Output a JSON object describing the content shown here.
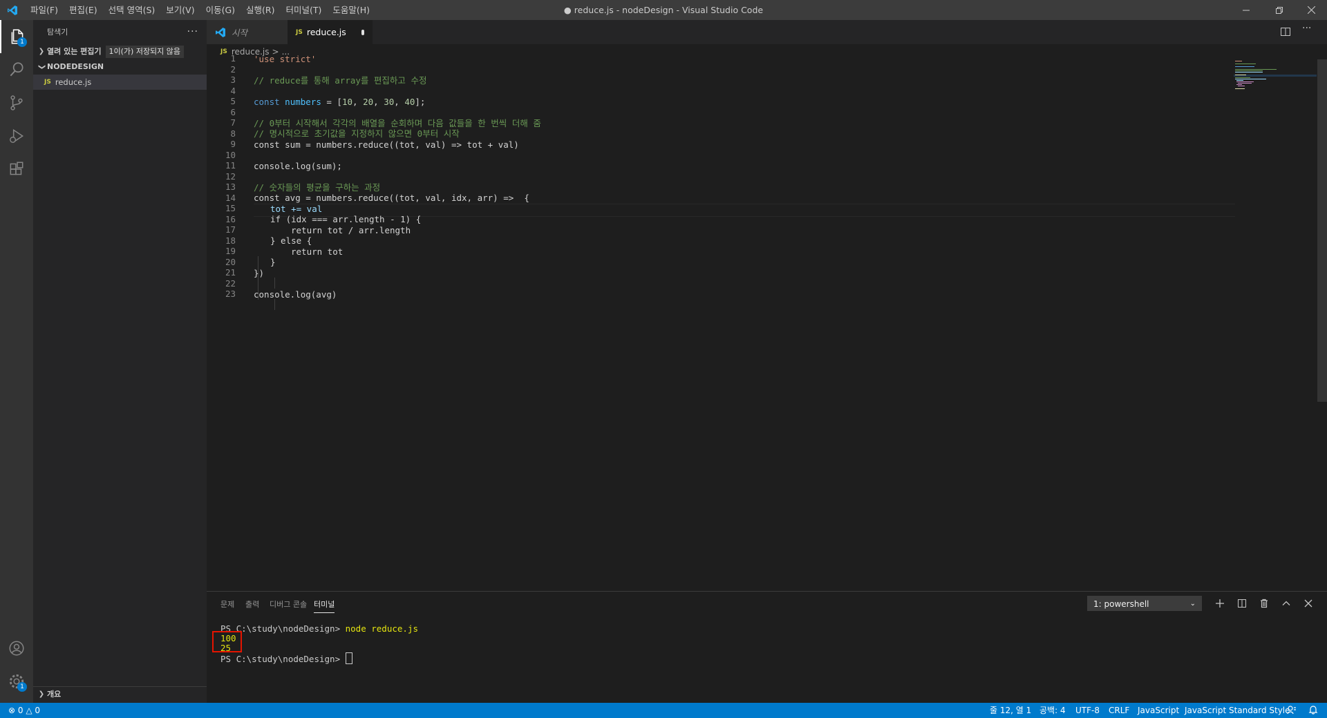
{
  "titlebar": {
    "menus": [
      "파일(F)",
      "편집(E)",
      "선택 영역(S)",
      "보기(V)",
      "이동(G)",
      "실행(R)",
      "터미널(T)",
      "도움말(H)"
    ],
    "title": "● reduce.js - nodeDesign - Visual Studio Code"
  },
  "activitybar": {
    "explorer_badge": "1",
    "settings_badge": "1"
  },
  "sidebar": {
    "title": "탐색기",
    "more": "···",
    "open_editors": "열려 있는 편집기",
    "unsaved_tooltip": "1이(가) 저장되지 않음",
    "folder": "NODEDESIGN",
    "file": "reduce.js",
    "file_badge": "JS",
    "outline": "개요"
  },
  "tabs": [
    {
      "label": "시작"
    },
    {
      "label": "reduce.js",
      "badge": "JS"
    }
  ],
  "breadcrumb": {
    "badge": "JS",
    "file": "reduce.js",
    "sep": ">",
    "rest": "..."
  },
  "editor": {
    "line_numbers": [
      "1",
      "2",
      "3",
      "4",
      "5",
      "6",
      "7",
      "8",
      "9",
      "10",
      "11",
      "12",
      "13",
      "14",
      "15",
      "16",
      "17",
      "18",
      "19",
      "20",
      "21",
      "22",
      "23"
    ],
    "lines": {
      "l1": "'use strict'",
      "l3": "// reduce를 통해 array를 편집하고 수정",
      "l5_kw": "const",
      "l5_var": "numbers",
      "l5_rest": " = [",
      "l5_nums": [
        "10",
        "20",
        "30",
        "40"
      ],
      "l5_end": "];",
      "l7": "// 0부터 시작해서 각각의 배열을 순회하며 다음 값들을 한 번씩 더해 줌",
      "l8": "// 명시적으로 초기값을 지정하지 않으면 0부터 시작",
      "l9": "const sum = numbers.reduce((tot, val) => tot + val)",
      "l11": "console.log(sum);",
      "l13": "// 숫자들의 평균을 구하는 과정",
      "l14": "const avg = numbers.reduce((tot, val, idx, arr) =>  {",
      "l15": "tot += val",
      "l16": "if (idx === arr.length - 1) {",
      "l17": "return tot / arr.length",
      "l18": "} else {",
      "l19": "return tot",
      "l20": "}",
      "l21": "})",
      "l23": "console.log(avg)"
    }
  },
  "panel": {
    "tabs": [
      "문제",
      "출력",
      "디버그 콘솔",
      "터미널"
    ],
    "terminal_select": "1: powershell",
    "prompt": "PS C:\\study\\nodeDesign>",
    "command": "node reduce.js",
    "output": [
      "100",
      "25"
    ]
  },
  "statusbar": {
    "errors": "0",
    "warnings": "0",
    "position": "줄 12, 열 1",
    "spaces": "공백: 4",
    "encoding": "UTF-8",
    "eol": "CRLF",
    "language": "JavaScript",
    "style": "JavaScript Standard Style"
  }
}
